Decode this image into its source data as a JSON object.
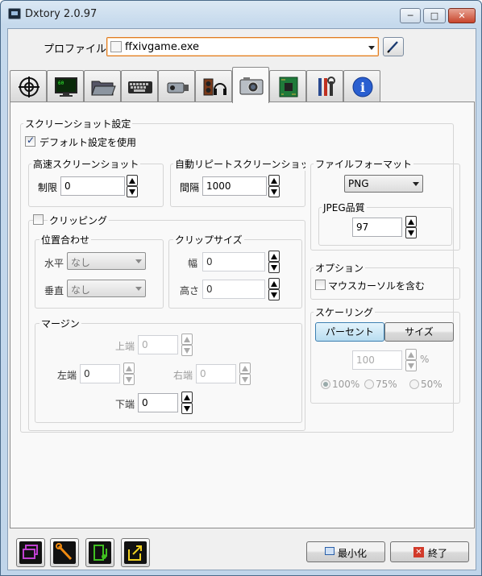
{
  "window": {
    "title": "Dxtory 2.0.97",
    "controls": {
      "minimize": "─",
      "maximize": "□",
      "close": "✕"
    }
  },
  "profile": {
    "label": "プロファイル",
    "value": "ffxivgame.exe"
  },
  "tabs": [
    {
      "icon": "target-icon"
    },
    {
      "icon": "monitor-icon"
    },
    {
      "icon": "folder-icon"
    },
    {
      "icon": "keyboard-icon"
    },
    {
      "icon": "camcorder-icon"
    },
    {
      "icon": "audio-icon"
    },
    {
      "icon": "camera-icon",
      "active": true
    },
    {
      "icon": "chip-icon"
    },
    {
      "icon": "tools-icon"
    },
    {
      "icon": "info-icon",
      "text": "i"
    }
  ],
  "screenshot_settings": {
    "title": "スクリーンショット設定",
    "use_default": {
      "label": "デフォルト設定を使用",
      "checked": true
    },
    "fast": {
      "title": "高速スクリーンショット",
      "limit_label": "制限",
      "limit_value": "0"
    },
    "auto_repeat": {
      "title": "自動リピートスクリーンショッ",
      "interval_label": "間隔",
      "interval_value": "1000"
    },
    "clipping": {
      "label": "クリッピング",
      "checked": false,
      "position": {
        "title": "位置合わせ",
        "horizontal_label": "水平",
        "horizontal_value": "なし",
        "vertical_label": "垂直",
        "vertical_value": "なし"
      },
      "clip_size": {
        "title": "クリップサイズ",
        "width_label": "幅",
        "width_value": "0",
        "height_label": "高さ",
        "height_value": "0"
      },
      "margin": {
        "title": "マージン",
        "top_label": "上端",
        "top_value": "0",
        "left_label": "左端",
        "left_value": "0",
        "right_label": "右端",
        "right_value": "0",
        "bottom_label": "下端",
        "bottom_value": "0"
      }
    },
    "file_format": {
      "title": "ファイルフォーマット",
      "format_value": "PNG",
      "jpeg_quality_label": "JPEG品質",
      "jpeg_quality_value": "97"
    },
    "options": {
      "title": "オプション",
      "include_cursor_label": "マウスカーソルを含む",
      "include_cursor_checked": false
    },
    "scaling": {
      "title": "スケーリング",
      "percent_label": "パーセント",
      "size_label": "サイズ",
      "percent_value": "100",
      "percent_unit": "%",
      "presets": [
        {
          "label": "100%",
          "selected": true
        },
        {
          "label": "75%",
          "selected": false
        },
        {
          "label": "50%",
          "selected": false
        }
      ]
    }
  },
  "footer": {
    "icon_buttons": [
      {
        "icon": "windows-icon",
        "color": "#c040d0"
      },
      {
        "icon": "wrench-icon",
        "color": "#f08a10"
      },
      {
        "icon": "music-doc-icon",
        "color": "#40c020"
      },
      {
        "icon": "export-icon",
        "color": "#f0d020"
      }
    ],
    "minimize_label": "最小化",
    "exit_label": "終了"
  }
}
